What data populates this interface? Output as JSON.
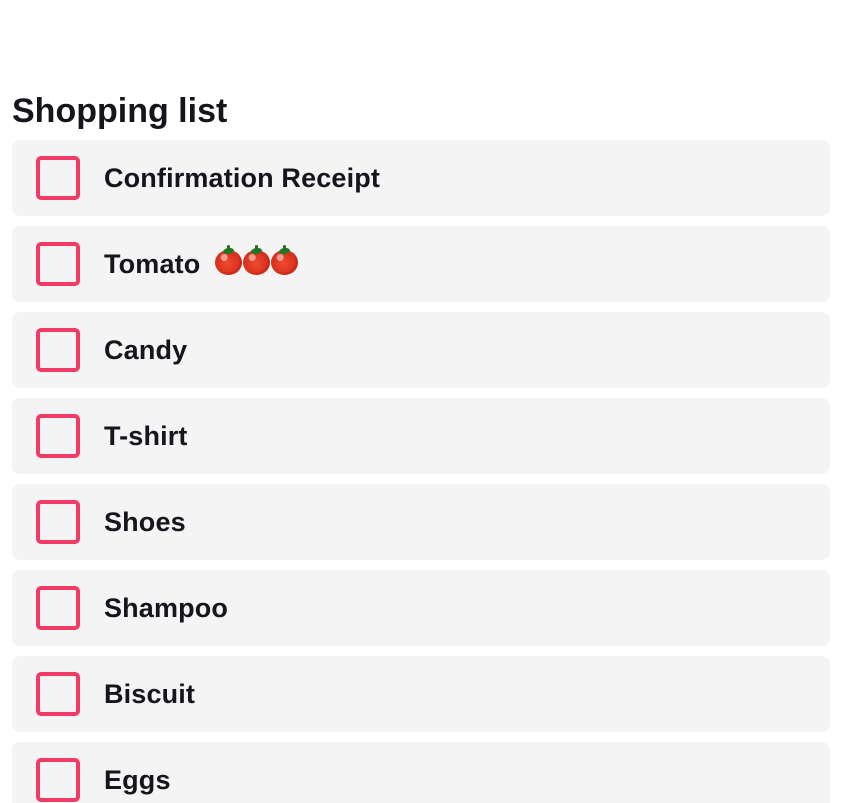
{
  "title": "Shopping list",
  "accent_color": "#f13b67",
  "items": [
    {
      "label": "Confirmation Receipt",
      "checked": false
    },
    {
      "label": "Tomato",
      "checked": false,
      "emoji": [
        "tomato-icon",
        "tomato-icon",
        "tomato-icon"
      ]
    },
    {
      "label": "Candy",
      "checked": false
    },
    {
      "label": "T-shirt",
      "checked": false
    },
    {
      "label": "Shoes",
      "checked": false
    },
    {
      "label": "Shampoo",
      "checked": false
    },
    {
      "label": "Biscuit",
      "checked": false
    },
    {
      "label": "Eggs",
      "checked": false
    }
  ]
}
